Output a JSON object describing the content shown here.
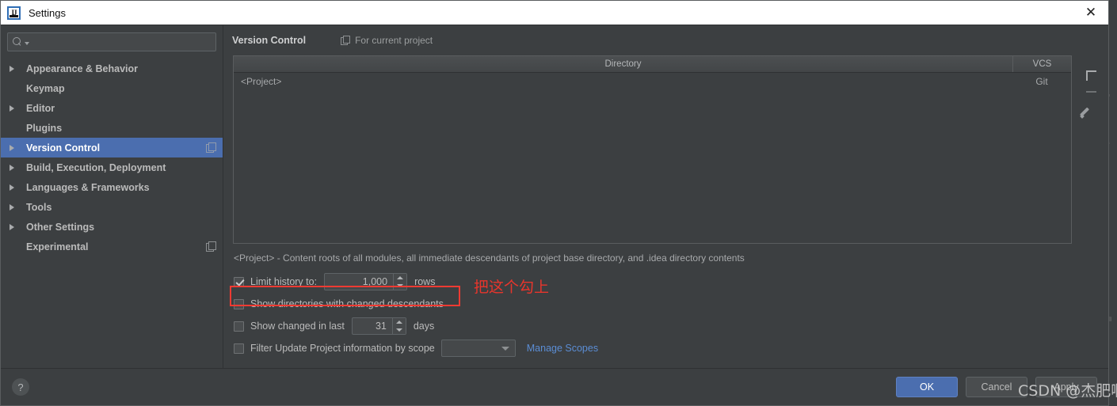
{
  "window": {
    "title": "Settings",
    "app_icon": "intellij-idea-icon",
    "close_label": "✕"
  },
  "sidebar": {
    "search": {
      "value": "",
      "placeholder": "",
      "icon": "search-icon"
    },
    "items": [
      {
        "label": "Appearance & Behavior",
        "expandable": true,
        "selected": false,
        "badge": false
      },
      {
        "label": "Keymap",
        "expandable": false,
        "selected": false,
        "badge": false
      },
      {
        "label": "Editor",
        "expandable": true,
        "selected": false,
        "badge": false
      },
      {
        "label": "Plugins",
        "expandable": false,
        "selected": false,
        "badge": false
      },
      {
        "label": "Version Control",
        "expandable": true,
        "selected": true,
        "badge": true
      },
      {
        "label": "Build, Execution, Deployment",
        "expandable": true,
        "selected": false,
        "badge": false
      },
      {
        "label": "Languages & Frameworks",
        "expandable": true,
        "selected": false,
        "badge": false
      },
      {
        "label": "Tools",
        "expandable": true,
        "selected": false,
        "badge": false
      },
      {
        "label": "Other Settings",
        "expandable": true,
        "selected": false,
        "badge": false
      },
      {
        "label": "Experimental",
        "expandable": false,
        "selected": false,
        "badge": true
      }
    ]
  },
  "main": {
    "title": "Version Control",
    "scope_label": "For current project",
    "scope_icon": "project-scope-icon",
    "table": {
      "columns": [
        "Directory",
        "VCS"
      ],
      "rows": [
        {
          "directory": "<Project>",
          "vcs": "Git"
        }
      ],
      "toolbar": [
        {
          "name": "add-directory-button",
          "icon": "plus-icon"
        },
        {
          "name": "remove-directory-button",
          "icon": "minus-icon"
        },
        {
          "name": "edit-directory-button",
          "icon": "pencil-icon"
        }
      ]
    },
    "hint": "<Project> - Content roots of all modules, all immediate descendants of project base directory, and .idea directory contents",
    "options": {
      "limit_history": {
        "label": "Limit history to:",
        "checked": true,
        "value": "1,000",
        "unit": "rows"
      },
      "show_directories": {
        "label": "Show directories with changed descendants",
        "checked": false,
        "highlighted": true
      },
      "show_changed_in_last": {
        "label": "Show changed in last",
        "checked": false,
        "value": "31",
        "unit": "days"
      },
      "filter_by_scope": {
        "label": "Filter Update Project information by scope",
        "checked": false,
        "combo_value": "",
        "link_label": "Manage Scopes"
      }
    }
  },
  "annotation": {
    "text": "把这个勾上",
    "color": "#e8352c"
  },
  "footer": {
    "help_label": "?",
    "buttons": [
      {
        "label": "OK",
        "style": "primary"
      },
      {
        "label": "Cancel",
        "style": "normal"
      },
      {
        "label": "Apply",
        "style": "normal"
      }
    ]
  },
  "watermark": {
    "text": "CSDN @杰肥啊"
  },
  "colors": {
    "accent": "#4b6eaf",
    "background": "#3c3f41",
    "link": "#5b8dd4",
    "annotation": "#e8352c"
  }
}
